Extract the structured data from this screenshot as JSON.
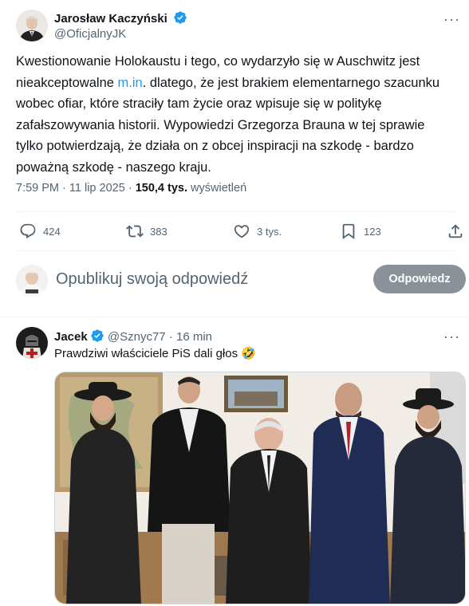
{
  "main_tweet": {
    "author_name": "Jarosław Kaczyński",
    "author_handle": "@OficjalnyJK",
    "text_before_link": "Kwestionowanie Holokaustu i tego, co wydarzyło się w Auschwitz jest nieakceptowalne ",
    "link_text": "m.in",
    "text_after_link": ". dlatego, że jest brakiem elementarnego szacunku wobec ofiar, które straciły tam życie oraz wpisuje się w politykę zafałszowywania historii. Wypowiedzi Grzegorza Brauna w tej sprawie tylko potwierdzają, że działa on z obcej inspiracji na szkodę - bardzo poważną szkodę - naszego kraju.",
    "time": "7:59 PM",
    "separator": "·",
    "date": "11 lip 2025",
    "views_count": "150,4 tys.",
    "views_label": "wyświetleń",
    "replies": "424",
    "reposts": "383",
    "likes": "3 tys.",
    "bookmarks": "123"
  },
  "reply_composer": {
    "placeholder": "Opublikuj swoją odpowiedź",
    "button_label": "Odpowiedz"
  },
  "reply_tweet": {
    "author_name": "Jacek",
    "author_handle": "@Sznyc77",
    "separator": "·",
    "time_ago": "16 min",
    "text": "Prawdziwi właściciele PiS dali głos 🤣"
  },
  "colors": {
    "accent": "#1d9bf0",
    "secondary_text": "#536471",
    "button_disabled": "#8b9198",
    "divider": "#eff3f4"
  }
}
